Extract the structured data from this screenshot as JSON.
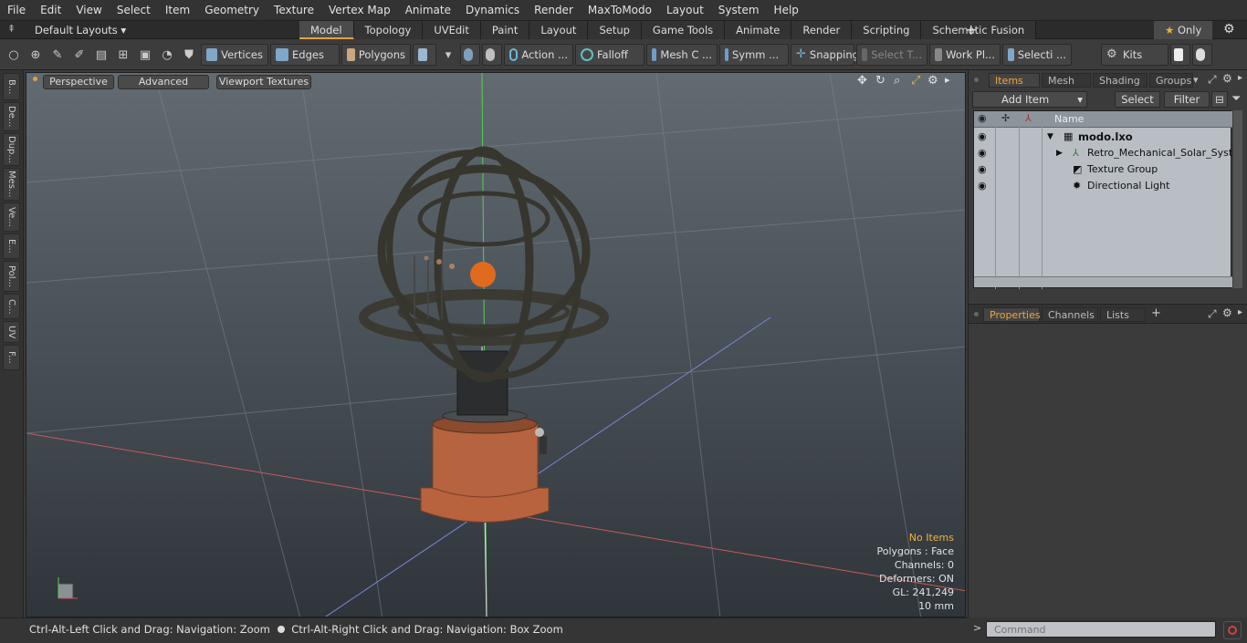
{
  "menu": [
    "File",
    "Edit",
    "View",
    "Select",
    "Item",
    "Geometry",
    "Texture",
    "Vertex Map",
    "Animate",
    "Dynamics",
    "Render",
    "MaxToModo",
    "Layout",
    "System",
    "Help"
  ],
  "layout_selector": "Default Layouts",
  "layout_tabs": [
    "Model",
    "Topology",
    "UVEdit",
    "Paint",
    "Layout",
    "Setup",
    "Game Tools",
    "Animate",
    "Render",
    "Scripting",
    "Schematic Fusion"
  ],
  "only_label": "Only",
  "toolbar": {
    "vertices": "Vertices",
    "edges": "Edges",
    "polygons": "Polygons",
    "action": "Action ...",
    "falloff": "Falloff",
    "mesh": "Mesh C ...",
    "symm": "Symm ...",
    "snapping": "Snapping",
    "select_t": "Select T...",
    "work_pl": "Work Pl...",
    "selecti": "Selecti ...",
    "kits": "Kits"
  },
  "left_tabs": [
    "B...",
    "De...",
    "Dup...",
    "Mes...",
    "Ve...",
    "E...",
    "Pol...",
    "C...",
    "UV",
    "F..."
  ],
  "viewport": {
    "perspective": "Perspective",
    "advanced": "Advanced",
    "textures": "Viewport Textures",
    "stats": {
      "no_items": "No Items",
      "polygons": "Polygons : Face",
      "channels": "Channels: 0",
      "deformers": "Deformers: ON",
      "gl": "GL: 241,249",
      "scale": "10 mm"
    }
  },
  "status": {
    "hint1": "Ctrl-Alt-Left Click and Drag: Navigation: Zoom",
    "hint2": "Ctrl-Alt-Right Click and Drag: Navigation: Box Zoom"
  },
  "items_panel": {
    "tabs": [
      "Items",
      "Mesh ...",
      "Shading",
      "Groups"
    ],
    "add_item": "Add Item",
    "select": "Select",
    "filter": "Filter",
    "col_name": "Name",
    "rows": [
      {
        "label": "modo.lxo"
      },
      {
        "label": "Retro_Mechanical_Solar_Syst..."
      },
      {
        "label": "Texture Group"
      },
      {
        "label": "Directional Light"
      }
    ]
  },
  "props_panel": {
    "tabs": [
      "Properties",
      "Channels",
      "Lists"
    ]
  },
  "command_placeholder": "Command"
}
